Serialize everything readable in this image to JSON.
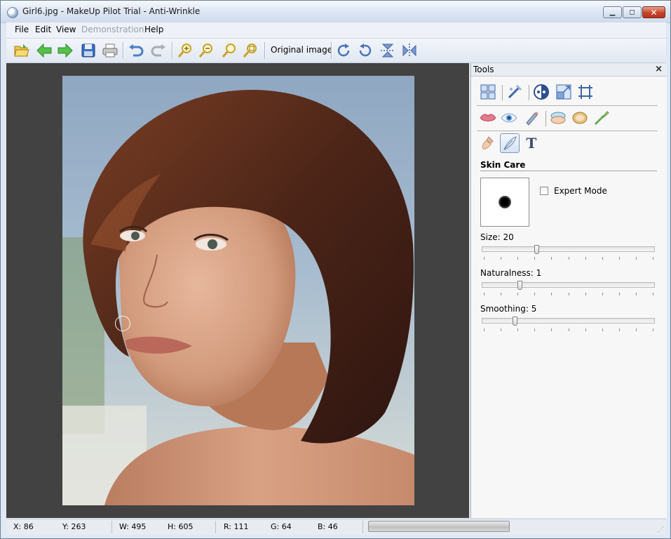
{
  "window": {
    "title": "Girl6.jpg - MakeUp Pilot Trial - Anti-Wrinkle",
    "controls": {
      "minimize": "minimize",
      "maximize": "maximize",
      "close": "close"
    }
  },
  "menu": {
    "items": [
      {
        "label": "File",
        "enabled": true
      },
      {
        "label": "Edit",
        "enabled": true
      },
      {
        "label": "View",
        "enabled": true
      },
      {
        "label": "Demonstration",
        "enabled": false
      },
      {
        "label": "Help",
        "enabled": true
      }
    ]
  },
  "toolbar": {
    "original_image_label": "Original image",
    "icons": [
      "open-folder-icon",
      "back-arrow-icon",
      "forward-arrow-icon",
      "save-icon",
      "print-icon",
      "undo-icon",
      "redo-icon",
      "zoom-in-icon",
      "zoom-out-icon",
      "zoom-fit-icon",
      "zoom-actual-icon",
      "rotate-right-icon",
      "rotate-left-icon",
      "flip-vertical-icon",
      "flip-horizontal-icon"
    ]
  },
  "tools_panel": {
    "title": "Tools",
    "close_label": "×",
    "section_title": "Skin Care",
    "expert_mode_label": "Expert Mode",
    "expert_mode_checked": false,
    "sliders": [
      {
        "label": "Size: 20",
        "value": 20,
        "position": 0.31
      },
      {
        "label": "Naturalness: 1",
        "value": 1,
        "position": 0.21
      },
      {
        "label": "Smoothing: 5",
        "value": 5,
        "position": 0.18
      }
    ],
    "tool_rows": [
      [
        "grid-layout-icon",
        "magic-wand-icon",
        "contrast-icon",
        "resize-icon",
        "crop-icon"
      ],
      [
        "lips-icon",
        "eye-icon",
        "eyeliner-icon",
        "face-powder-icon",
        "compact-icon",
        "brush-icon"
      ],
      [
        "foundation-icon",
        "skin-care-feather-icon",
        "text-tool-icon"
      ]
    ],
    "text_tool_glyph": "T"
  },
  "status": {
    "x": "X: 86",
    "y": "Y: 263",
    "w": "W: 495",
    "h": "H: 605",
    "r": "R: 111",
    "g": "G: 64",
    "b": "B: 46"
  },
  "colors": {
    "canvas_bg": "#424242",
    "panel_bg": "#f7f7f7",
    "hair": "#4a2417",
    "skin": "#d9a184"
  }
}
